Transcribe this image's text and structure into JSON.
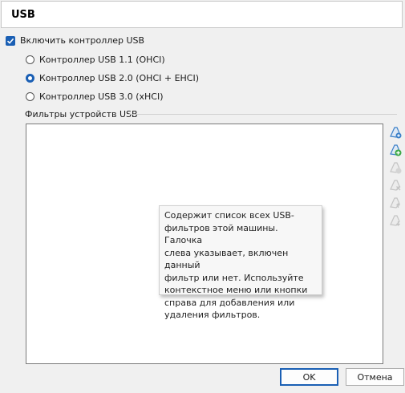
{
  "header": {
    "title": "USB"
  },
  "enable_controller": {
    "label": "Включить контроллер USB",
    "checked": true
  },
  "controllers": [
    {
      "label": "Контроллер USB 1.1 (OHCI)",
      "selected": false
    },
    {
      "label": "Контроллер USB 2.0 (OHCI + EHCI)",
      "selected": true
    },
    {
      "label": "Контроллер USB 3.0 (xHCI)",
      "selected": false
    }
  ],
  "filters": {
    "title": "Фильтры устройств USB",
    "tooltip_lines": [
      "Содержит список всех USB-",
      "фильтров этой машины. Галочка",
      "слева указывает, включен данный",
      "фильтр или нет. Используйте",
      "контекстное меню или кнопки",
      "справа для добавления или",
      "удаления фильтров."
    ]
  },
  "toolbar_icons": [
    "add-empty-filter-icon",
    "add-filter-from-device-icon",
    "edit-filter-icon",
    "remove-filter-icon",
    "move-up-icon",
    "move-down-icon"
  ],
  "buttons": {
    "ok": "OK",
    "cancel": "Отмена"
  },
  "colors": {
    "accent": "#1a5fb4",
    "icon_active": "#3a7fc8",
    "icon_disabled": "#c4c4c4"
  }
}
